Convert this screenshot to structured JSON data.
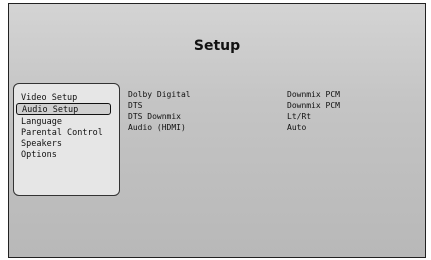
{
  "title": "Setup",
  "menu": {
    "items": [
      {
        "label": "Video Setup",
        "selected": false
      },
      {
        "label": "Audio Setup",
        "selected": true
      },
      {
        "label": "Language",
        "selected": false
      },
      {
        "label": "Parental Control",
        "selected": false
      },
      {
        "label": "Speakers",
        "selected": false
      },
      {
        "label": "Options",
        "selected": false
      }
    ]
  },
  "settings": [
    {
      "name": "Dolby Digital",
      "value": "Downmix PCM"
    },
    {
      "name": "DTS",
      "value": "Downmix PCM"
    },
    {
      "name": "DTS Downmix",
      "value": "Lt/Rt"
    },
    {
      "name": "Audio (HDMI)",
      "value": "Auto"
    }
  ]
}
